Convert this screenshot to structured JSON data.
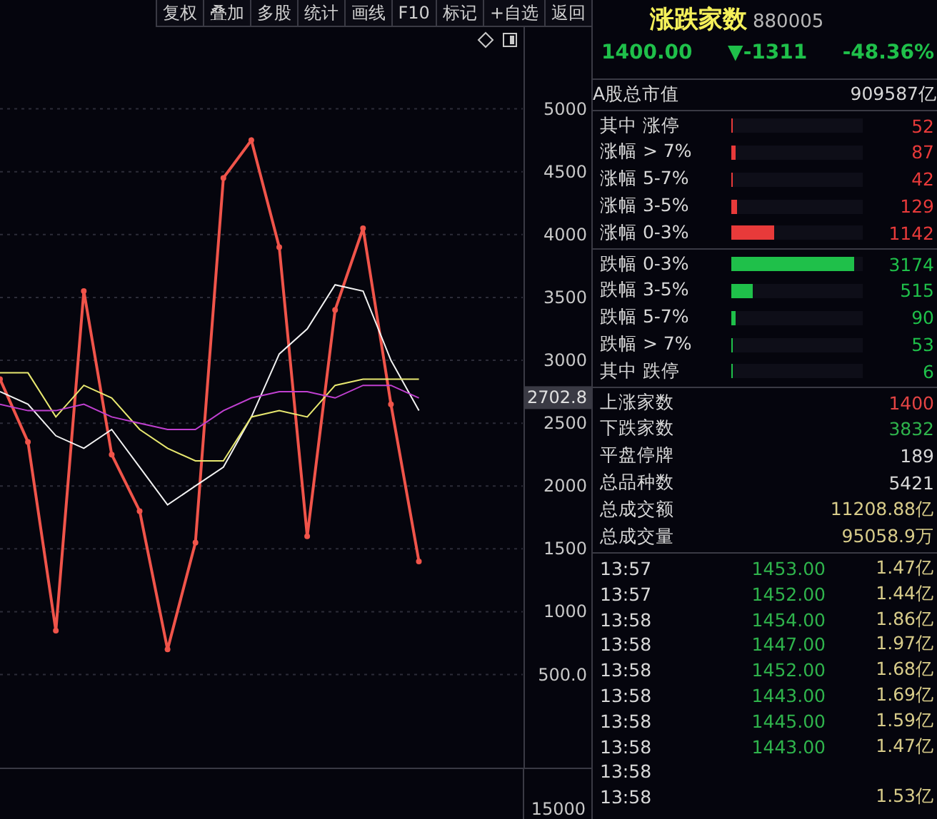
{
  "toolbar": [
    "复权",
    "叠加",
    "多股",
    "统计",
    "画线",
    "F10",
    "标记",
    "+自选",
    "返回"
  ],
  "chart": {
    "current_value": "2702.8",
    "volume_axis_label": "15000",
    "chart_data": {
      "type": "line",
      "ylim": [
        -240,
        5650
      ],
      "grid": true,
      "yticks": [
        {
          "value": 500,
          "label": "500.0"
        },
        1000,
        1500,
        2000,
        2500,
        3000,
        3500,
        4000,
        4500,
        5000
      ],
      "series": [
        {
          "color": "#f0544a",
          "marker": true,
          "values": [
            2850,
            2350,
            850,
            3550,
            2250,
            1800,
            700,
            1550,
            4450,
            4750,
            3900,
            1600,
            3400,
            4050,
            2650,
            1400
          ]
        },
        {
          "color": "#f2f2f2",
          "values": [
            2750,
            2650,
            2400,
            2300,
            2450,
            2150,
            1850,
            2000,
            2150,
            2550,
            3050,
            3250,
            3600,
            3550,
            3000,
            2600
          ]
        },
        {
          "color": "#e8e870",
          "values": [
            2900,
            2900,
            2550,
            2800,
            2700,
            2450,
            2300,
            2200,
            2200,
            2550,
            2600,
            2550,
            2800,
            2850,
            2850,
            2850
          ]
        },
        {
          "color": "#c040d0",
          "values": [
            2650,
            2600,
            2600,
            2650,
            2550,
            2500,
            2450,
            2450,
            2600,
            2700,
            2750,
            2750,
            2700,
            2800,
            2800,
            2700
          ]
        }
      ]
    }
  },
  "panel": {
    "title": "涨跌家数",
    "code": "880005",
    "price": "1400.00",
    "change": "▼-1311",
    "change_pct": "-48.36%",
    "market_cap": {
      "label": "A股总市值",
      "value": "909587亿"
    },
    "breakdown": [
      {
        "label": "其中 涨停",
        "value": "52",
        "color": "#e83a3a",
        "level": 0.01
      },
      {
        "label": "涨幅 > 7%",
        "value": "87",
        "color": "#e83a3a",
        "level": 0.03
      },
      {
        "label": "涨幅 5-7%",
        "value": "42",
        "color": "#e83a3a",
        "level": 0.01
      },
      {
        "label": "涨幅 3-5%",
        "value": "129",
        "color": "#e83a3a",
        "level": 0.04
      },
      {
        "label": "涨幅 0-3%",
        "value": "1142",
        "color": "#e83a3a",
        "level": 0.33
      },
      {
        "label": "跌幅 0-3%",
        "value": "3174",
        "color": "#1fc04a",
        "level": 0.93
      },
      {
        "label": "跌幅 3-5%",
        "value": "515",
        "color": "#1fc04a",
        "level": 0.16
      },
      {
        "label": "跌幅 5-7%",
        "value": "90",
        "color": "#1fc04a",
        "level": 0.03
      },
      {
        "label": "跌幅 > 7%",
        "value": "53",
        "color": "#1fc04a",
        "level": 0.01
      },
      {
        "label": "其中 跌停",
        "value": "6",
        "color": "#1fc04a",
        "level": 0.01
      }
    ],
    "stats": [
      {
        "label": "上涨家数",
        "value": "1400",
        "color": "#e24444"
      },
      {
        "label": "下跌家数",
        "value": "3832",
        "color": "#2fb34c"
      },
      {
        "label": "平盘停牌",
        "value": "189",
        "color": "#d8d8d8"
      },
      {
        "label": "总品种数",
        "value": "5421",
        "color": "#d8d8d8"
      },
      {
        "label": "总成交额",
        "value": "11208.88亿",
        "color": "#d8cc8a"
      },
      {
        "label": "总成交量",
        "value": "95058.9万",
        "color": "#d8cc8a"
      }
    ],
    "ticks": [
      {
        "time": "13:57",
        "price": "1453.00",
        "amount": "1.47亿"
      },
      {
        "time": "13:57",
        "price": "1452.00",
        "amount": "1.44亿"
      },
      {
        "time": "13:58",
        "price": "1454.00",
        "amount": "1.86亿"
      },
      {
        "time": "13:58",
        "price": "1447.00",
        "amount": "1.97亿"
      },
      {
        "time": "13:58",
        "price": "1452.00",
        "amount": "1.68亿"
      },
      {
        "time": "13:58",
        "price": "1443.00",
        "amount": "1.69亿"
      },
      {
        "time": "13:58",
        "price": "1445.00",
        "amount": "1.59亿"
      },
      {
        "time": "13:58",
        "price": "1443.00",
        "amount": "1.47亿"
      },
      {
        "time": "13:58"
      },
      {
        "time": "13:58",
        "amount": "1.53亿"
      }
    ]
  }
}
